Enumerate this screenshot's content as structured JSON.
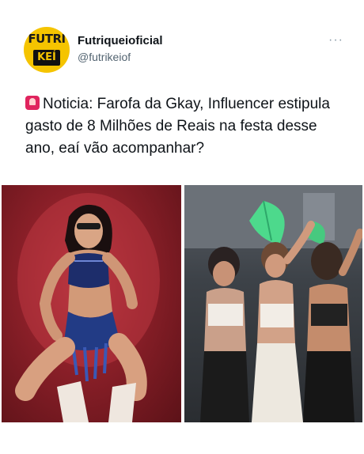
{
  "account": {
    "display_name": "Futriqueioficial",
    "handle": "@futrikeiof",
    "avatar_text_top": "FUTRÍ",
    "avatar_text_bottom": "KEÍ"
  },
  "tweet": {
    "text": "Noticia: Farofa da Gkay, Influencer estipula gasto de 8 Milhões de Reais na festa desse ano, eaí vão acompanhar?",
    "emoji_icon": "siren-icon"
  },
  "menu": {
    "more_label": "···"
  },
  "media": [
    {
      "name": "photo-gkay",
      "description_icon": "photo"
    },
    {
      "name": "photo-party",
      "description_icon": "photo"
    }
  ],
  "colors": {
    "avatar_bg": "#f5c400",
    "text": "#0f1419",
    "secondary_text": "#536471"
  }
}
